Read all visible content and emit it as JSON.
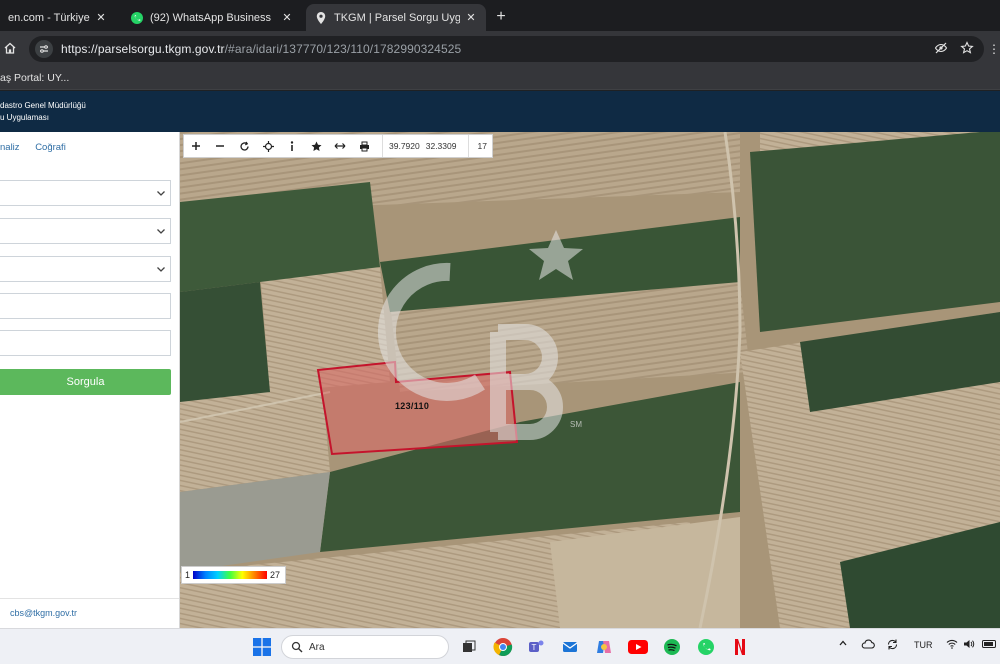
{
  "browser": {
    "tabs": [
      {
        "title": "en.com - Türkiye'nin Or",
        "active": false
      },
      {
        "title": "(92) WhatsApp Business",
        "active": false
      },
      {
        "title": "TKGM | Parsel Sorgu Uygulama",
        "active": true
      }
    ],
    "url_host": "https://parselsorgu.tkgm.gov.tr",
    "url_rest": "/#ara/idari/137770/123/110/1782990324525",
    "bookmark": "aş Portal: UY..."
  },
  "site": {
    "org_line1": "dastro Genel Müdürlüğü",
    "org_line2": "u Uygulaması"
  },
  "panel": {
    "tabs": [
      "naliz",
      "Coğrafi"
    ],
    "search_button": "Sorgula",
    "email": "cbs@tkgm.gov.tr"
  },
  "map": {
    "lat": "39.7920",
    "lon": "32.3309",
    "zoom": "17",
    "parcel_label": "123/110",
    "legend_min": "1",
    "legend_max": "27",
    "watermark_mark": "SM",
    "parcel_color": "#c4142c"
  },
  "taskbar": {
    "search_text": "Ara",
    "language": "TUR"
  }
}
